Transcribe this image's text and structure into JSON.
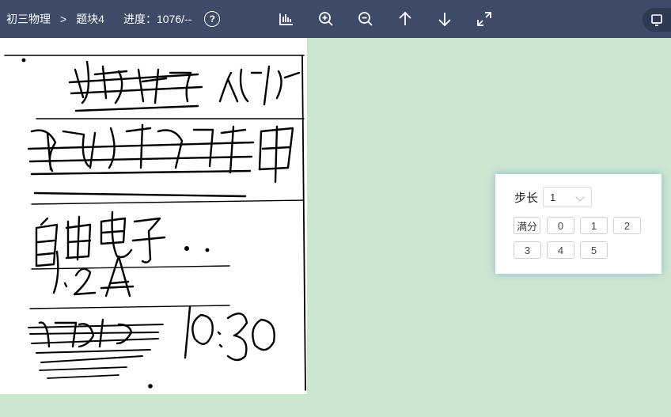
{
  "header": {
    "subject": "初三物理",
    "separator": ">",
    "question_block": "题块4",
    "progress_label": "进度：",
    "progress_value": "1076/--",
    "help_symbol": "?"
  },
  "toolbar": {
    "icons": [
      "bar-chart-icon",
      "zoom-in-icon",
      "zoom-out-icon",
      "arrow-up-icon",
      "arrow-down-icon",
      "fullscreen-icon",
      "panel-toggle-icon"
    ]
  },
  "score_panel": {
    "step_label": "步长",
    "step_value": "1",
    "full_score_label": "满分",
    "scores": [
      "0",
      "1",
      "2",
      "3",
      "4",
      "5"
    ]
  },
  "answer_sheet": {
    "handwritten_lines": [
      "热传递 加快",
      "带负电 摩擦 甲",
      "自由电子",
      "1.2A",
      "10:30"
    ]
  },
  "colors": {
    "topbar": "#3d4a68",
    "background": "#cde6d0",
    "panel_glow": "#78aad2"
  }
}
